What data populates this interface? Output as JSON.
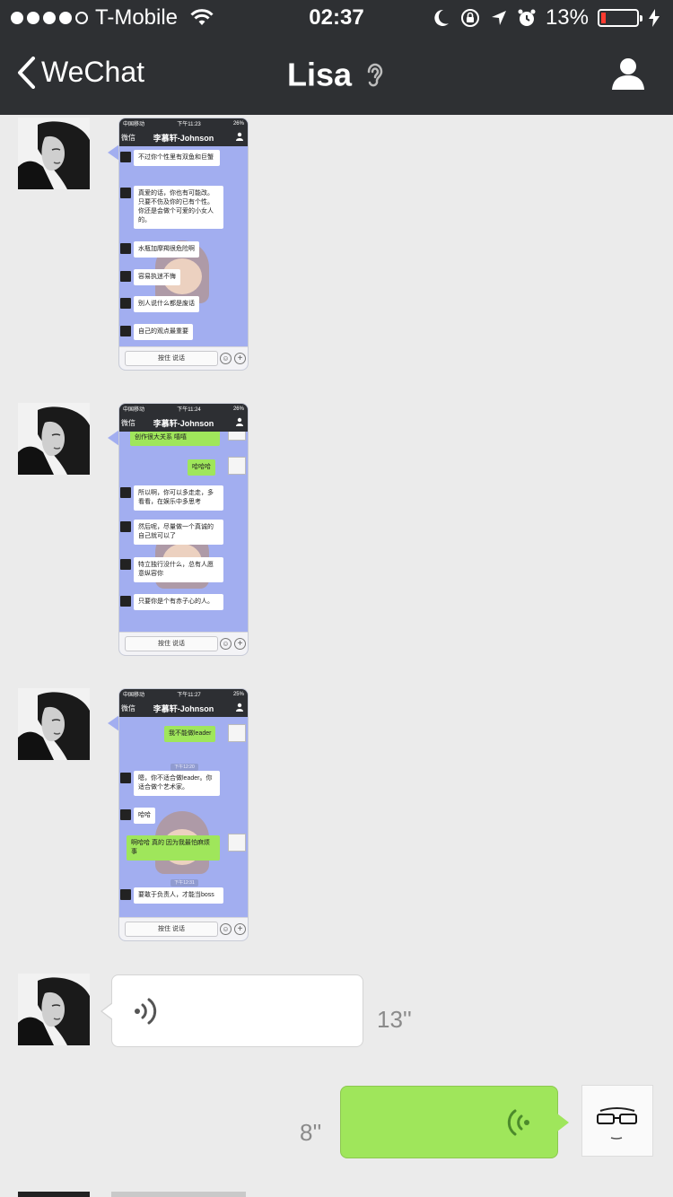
{
  "status_bar": {
    "carrier": "T-Mobile",
    "time": "02:37",
    "battery_percent": "13%",
    "battery_level": 0.13,
    "battery_color": "#ff3b30"
  },
  "nav": {
    "back_label": "WeChat",
    "title": "Lisa"
  },
  "screenshots": [
    {
      "status_carrier": "中国移动",
      "status_time": "下午11:23",
      "status_battery": "26%",
      "back": "微信",
      "title": "李慕轩-Johnson",
      "input_hint": "按住 说话",
      "messages": [
        {
          "text": "不过你个性里有双鱼和巨蟹"
        },
        {
          "text": "真爱的话，你也有可能改。只要不伤及你的已有个性。你还是会做个可爱的小女人的。"
        },
        {
          "text": "水瓶加摩羯很危险啊"
        },
        {
          "text": "容易执迷不悔"
        },
        {
          "text": "别人说什么都是废话"
        },
        {
          "text": "自己的观点最重要"
        }
      ]
    },
    {
      "status_carrier": "中国移动",
      "status_time": "下午11:24",
      "status_battery": "26%",
      "back": "微信",
      "title": "李慕轩-Johnson",
      "input_hint": "按住 说话",
      "messages": [
        {
          "text": "创作很大关系 嘻嘻",
          "side": "right"
        },
        {
          "text": "哈哈哈",
          "side": "right"
        },
        {
          "text": "所以啊，你可以多走走，多看看，在娱乐中多思考"
        },
        {
          "text": "然后呢，尽量做一个真诚的自己就可以了"
        },
        {
          "text": "特立独行没什么，总有人愿意纵容你"
        },
        {
          "text": "只要你是个有赤子心的人。"
        }
      ]
    },
    {
      "status_carrier": "中国移动",
      "status_time": "下午11:27",
      "status_battery": "25%",
      "back": "微信",
      "title": "李慕轩-Johnson",
      "input_hint": "按住 说话",
      "times": [
        "下午12:20",
        "下午12:31"
      ],
      "messages": [
        {
          "text": "我不能做leader",
          "side": "right"
        },
        {
          "text": "嗯，你不适合做leader。你适合做个艺术家。"
        },
        {
          "text": "哈哈"
        },
        {
          "text": "啊哈哈 真的 因为我最怕麻烦事",
          "side": "right"
        },
        {
          "text": "要敢于负责人，才能当boss"
        }
      ]
    }
  ],
  "voice_messages": [
    {
      "duration": "13''",
      "side": "left"
    },
    {
      "duration": "8''",
      "side": "right"
    }
  ],
  "colors": {
    "navbar": "#2e3033",
    "chat_bg": "#ebebeb",
    "outgoing_bubble": "#9fe65b",
    "incoming_bubble": "#ffffff"
  },
  "icons": {
    "back": "chevron-left-icon",
    "ear": "ear-icon",
    "profile": "person-icon",
    "voice_wave": "voice-wave-icon"
  }
}
